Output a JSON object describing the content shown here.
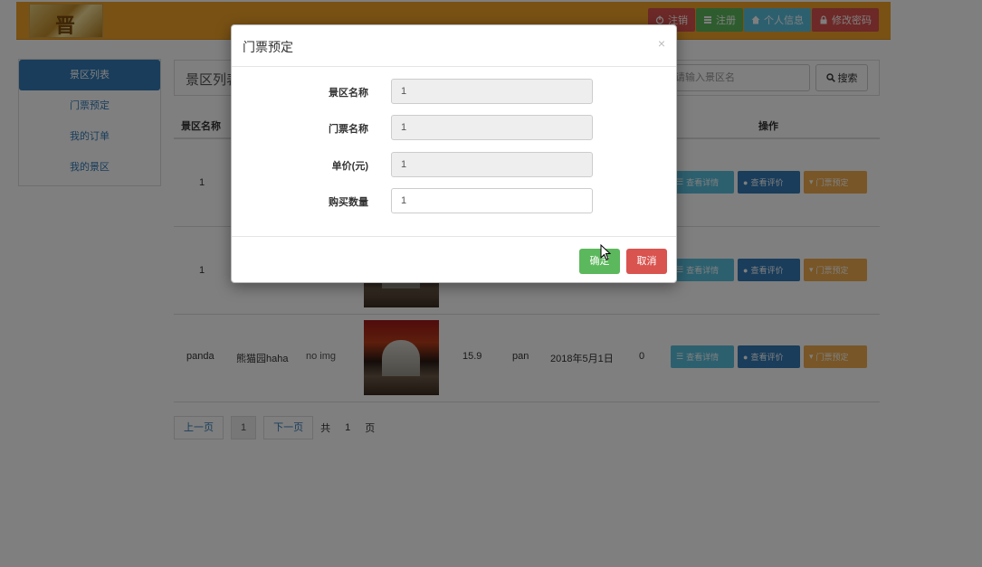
{
  "header": {
    "nav": [
      {
        "label": "注销",
        "icon": "power-icon"
      },
      {
        "label": "注册",
        "icon": "list-icon"
      },
      {
        "label": "个人信息",
        "icon": "home-icon"
      },
      {
        "label": "修改密码",
        "icon": "lock-icon"
      }
    ],
    "logo_text": "晋"
  },
  "sidebar": {
    "items": [
      {
        "label": "景区列表"
      },
      {
        "label": "门票预定"
      },
      {
        "label": "我的订单"
      },
      {
        "label": "我的景区"
      }
    ]
  },
  "panel": {
    "title": "景区列表",
    "search_placeholder": "请输入景区名",
    "search_button": "搜索"
  },
  "table": {
    "headers": {
      "name": "景区名称",
      "ops": "操作"
    },
    "rows": [
      {
        "name": "1"
      },
      {
        "name": "1"
      },
      {
        "name": "panda",
        "ticket": "熊猫园haha",
        "img_alt": "no img",
        "price": "15.9",
        "user": "pan",
        "date": "2018年5月1日",
        "count": "0"
      }
    ],
    "op_labels": {
      "detail": "查看详情",
      "review": "查看评价",
      "book": "门票预定"
    }
  },
  "pager": {
    "prev": "上一页",
    "current": "1",
    "next": "下一页",
    "total_prefix": "共",
    "total": "1",
    "total_suffix": "页"
  },
  "modal": {
    "title": "门票预定",
    "close": "×",
    "fields": [
      {
        "label": "景区名称",
        "value": "1",
        "readonly": true
      },
      {
        "label": "门票名称",
        "value": "1",
        "readonly": true
      },
      {
        "label": "单价(元)",
        "value": "1",
        "readonly": true
      },
      {
        "label": "购买数量",
        "value": "1",
        "readonly": false
      }
    ],
    "confirm": "确定",
    "cancel": "取消"
  },
  "colors": {
    "header_bg": "#f3a328",
    "primary": "#337ab7",
    "success": "#5cb85c",
    "danger": "#d9534f",
    "info": "#5bc0de",
    "warning": "#f0ad4e"
  }
}
